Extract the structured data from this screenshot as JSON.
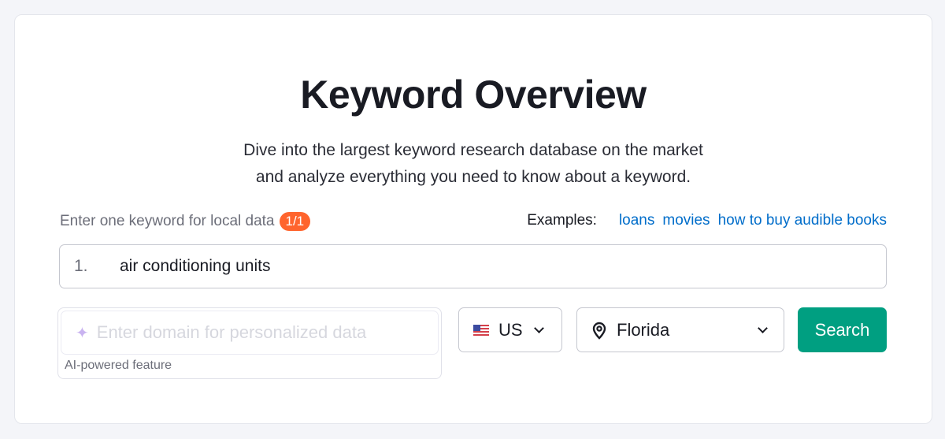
{
  "header": {
    "title": "Keyword Overview",
    "subtitle_line1": "Dive into the largest keyword research database on the market",
    "subtitle_line2": "and analyze everything you need to know about a keyword."
  },
  "keyword_section": {
    "label": "Enter one keyword for local data",
    "count_badge": "1/1",
    "examples_label": "Examples:",
    "examples": [
      "loans",
      "movies",
      "how to buy audible books"
    ],
    "row_number": "1.",
    "keyword_value": "air conditioning units"
  },
  "domain": {
    "placeholder": "Enter domain for personalized data",
    "note": "AI-powered feature",
    "icon": "sparkle-icon"
  },
  "country": {
    "value": "US",
    "icon": "us-flag-icon"
  },
  "location": {
    "value": "Florida",
    "icon": "location-pin-icon"
  },
  "search_button": {
    "label": "Search",
    "color": "#009f81"
  },
  "colors": {
    "badge": "#ff642d",
    "link": "#006dca"
  }
}
